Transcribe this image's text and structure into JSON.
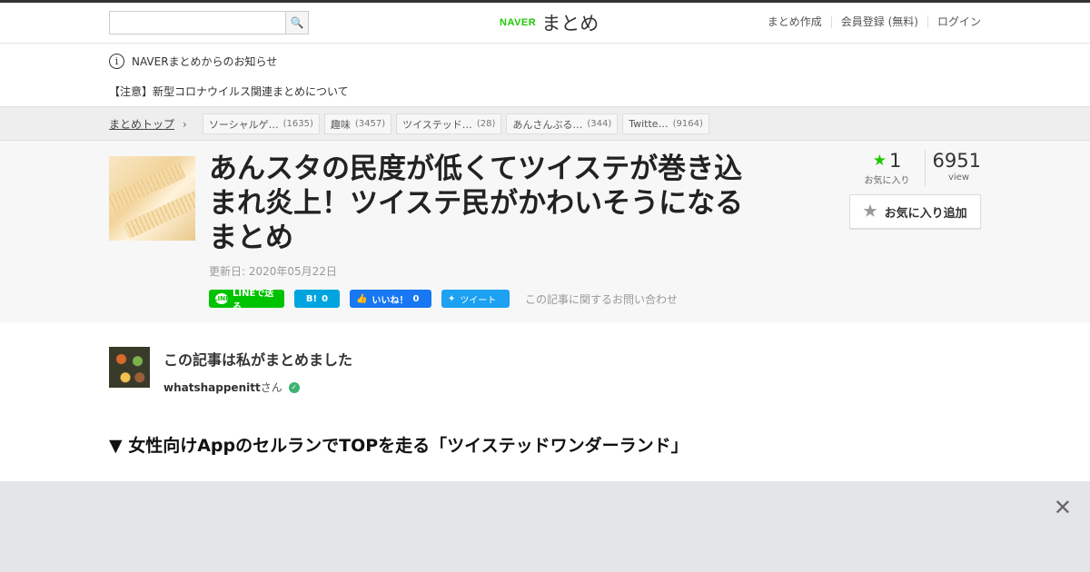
{
  "header": {
    "search_placeholder": "",
    "search_button_icon": "search-icon",
    "logo_brand": "NAVER",
    "logo_text": "まとめ",
    "links": [
      "まとめ作成",
      "会員登録 (無料)",
      "ログイン"
    ]
  },
  "notice": {
    "title": "NAVERまとめからのお知らせ",
    "item": "【注意】新型コロナウイルス関連まとめについて"
  },
  "breadcrumb": {
    "top": "まとめトップ",
    "tags": [
      {
        "label": "ソーシャルゲ…",
        "count": "(1635)"
      },
      {
        "label": "趣味",
        "count": "(3457)"
      },
      {
        "label": "ツイステッド…",
        "count": "(28)"
      },
      {
        "label": "あんさんぶる…",
        "count": "(344)"
      },
      {
        "label": "Twitte…",
        "count": "(9164)"
      }
    ]
  },
  "article": {
    "title": "あんスタの民度が低くてツイステが巻き込まれ炎上！ツイステ民がかわいそうになるまとめ",
    "updated": "更新日: 2020年05月22日",
    "share": {
      "line": "LINEで送る",
      "hatena_count": "0",
      "facebook": "いいね！",
      "facebook_count": "0",
      "tweet": "ツイート",
      "inquiry": "この記事に関するお問い合わせ"
    },
    "favorites_count": "1",
    "favorites_label": "お気に入り",
    "view_count": "6951",
    "view_label": "view",
    "fav_button": "お気に入り追加"
  },
  "author": {
    "title": "この記事は私がまとめました",
    "name": "whatshappenitt",
    "suffix": "さん"
  },
  "section_heading": "▼ 女性向けAppのセルランでTOPを走る「ツイステッドワンダーランド」",
  "colors": {
    "brand_green": "#1ec800",
    "line_green": "#00c300",
    "hatena_blue": "#00a4de",
    "facebook_blue": "#1877f2",
    "twitter_blue": "#1da1f2"
  }
}
